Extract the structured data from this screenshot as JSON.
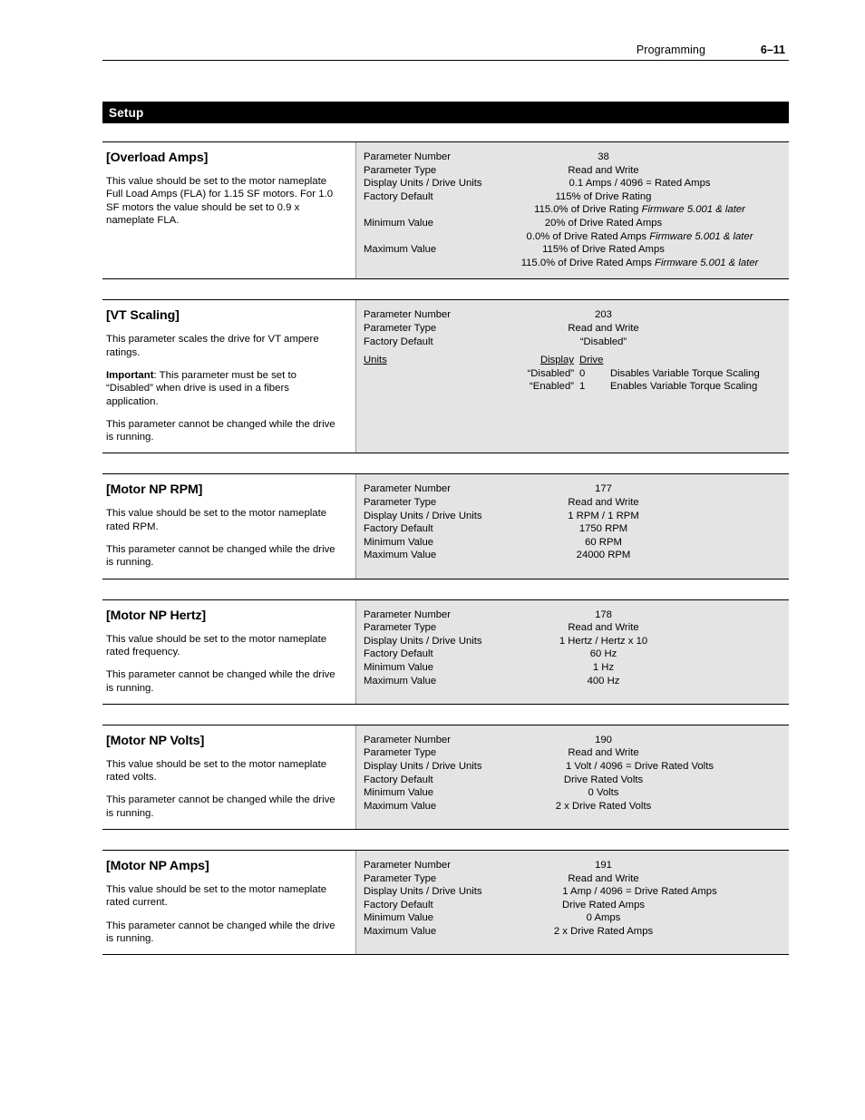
{
  "header": {
    "chapter": "Programming",
    "page": "6–11"
  },
  "section": {
    "title": "Setup"
  },
  "labels": {
    "parameter_number": "Parameter Number",
    "parameter_type": "Parameter Type",
    "display_drive_units": "Display Units / Drive Units",
    "factory_default": "Factory Default",
    "minimum_value": "Minimum Value",
    "maximum_value": "Maximum Value",
    "units": "Units",
    "display": "Display",
    "drive": "Drive"
  },
  "blocks": [
    {
      "title": "[Overload Amps]",
      "desc": [
        "This value should be set to the motor nameplate Full Load Amps (FLA) for 1.15 SF motors. For 1.0 SF motors the value should be set to 0.9 x nameplate FLA."
      ],
      "parameter_number": "38",
      "parameter_type": "Read and Write",
      "display_drive_units": "0.1 Amps / 4096 = Rated Amps",
      "factory_default": "115% of Drive Rating",
      "factory_default_alt": "115.0% of Drive Rating",
      "factory_default_alt_note": "Firmware 5.001 & later",
      "minimum_value": "20% of Drive Rated Amps",
      "minimum_value_alt": "0.0% of Drive Rated Amps",
      "minimum_value_alt_note": "Firmware 5.001 & later",
      "maximum_value": "115% of Drive Rated Amps",
      "maximum_value_alt": "115.0% of Drive Rated Amps",
      "maximum_value_alt_note": "Firmware 5.001 & later"
    },
    {
      "title": "[VT Scaling]",
      "desc": [
        "This parameter scales the drive for VT ampere ratings.",
        "Important: This parameter must be set to “Disabled” when drive is used in a fibers application.",
        "This parameter cannot be changed while the drive is running."
      ],
      "desc_bold_prefix": "Important",
      "parameter_number": "203",
      "parameter_type": "Read and Write",
      "factory_default": "“Disabled”",
      "enum": [
        {
          "display": "“Disabled”",
          "drive": "0",
          "description": "Disables Variable Torque Scaling"
        },
        {
          "display": "“Enabled”",
          "drive": "1",
          "description": "Enables Variable Torque Scaling"
        }
      ]
    },
    {
      "title": "[Motor NP RPM]",
      "desc": [
        "This value should be set to the motor nameplate rated RPM.",
        "This parameter cannot be changed while the drive is running."
      ],
      "parameter_number": "177",
      "parameter_type": "Read and Write",
      "display_drive_units": "1 RPM / 1 RPM",
      "factory_default": "1750 RPM",
      "minimum_value": "60 RPM",
      "maximum_value": "24000 RPM"
    },
    {
      "title": "[Motor NP Hertz]",
      "desc": [
        "This value should be set to the motor nameplate rated frequency.",
        "This parameter cannot be changed while the drive is running."
      ],
      "parameter_number": "178",
      "parameter_type": "Read and Write",
      "display_drive_units": "1 Hertz / Hertz x 10",
      "factory_default": "60 Hz",
      "minimum_value": "1 Hz",
      "maximum_value": "400 Hz"
    },
    {
      "title": "[Motor NP Volts]",
      "desc": [
        "This value should be set to the motor nameplate rated volts.",
        "This parameter cannot be changed while the drive is running."
      ],
      "parameter_number": "190",
      "parameter_type": "Read and Write",
      "display_drive_units": "1 Volt / 4096 = Drive Rated Volts",
      "factory_default": "Drive Rated Volts",
      "minimum_value": "0 Volts",
      "maximum_value": "2 x Drive Rated Volts"
    },
    {
      "title": "[Motor NP Amps]",
      "desc": [
        "This value should be set to the motor nameplate rated current.",
        "This parameter cannot be changed while the drive is running."
      ],
      "parameter_number": "191",
      "parameter_type": "Read and Write",
      "display_drive_units": "1 Amp / 4096 = Drive Rated Amps",
      "factory_default": "Drive Rated Amps",
      "minimum_value": "0 Amps",
      "maximum_value": "2 x Drive Rated Amps"
    }
  ]
}
